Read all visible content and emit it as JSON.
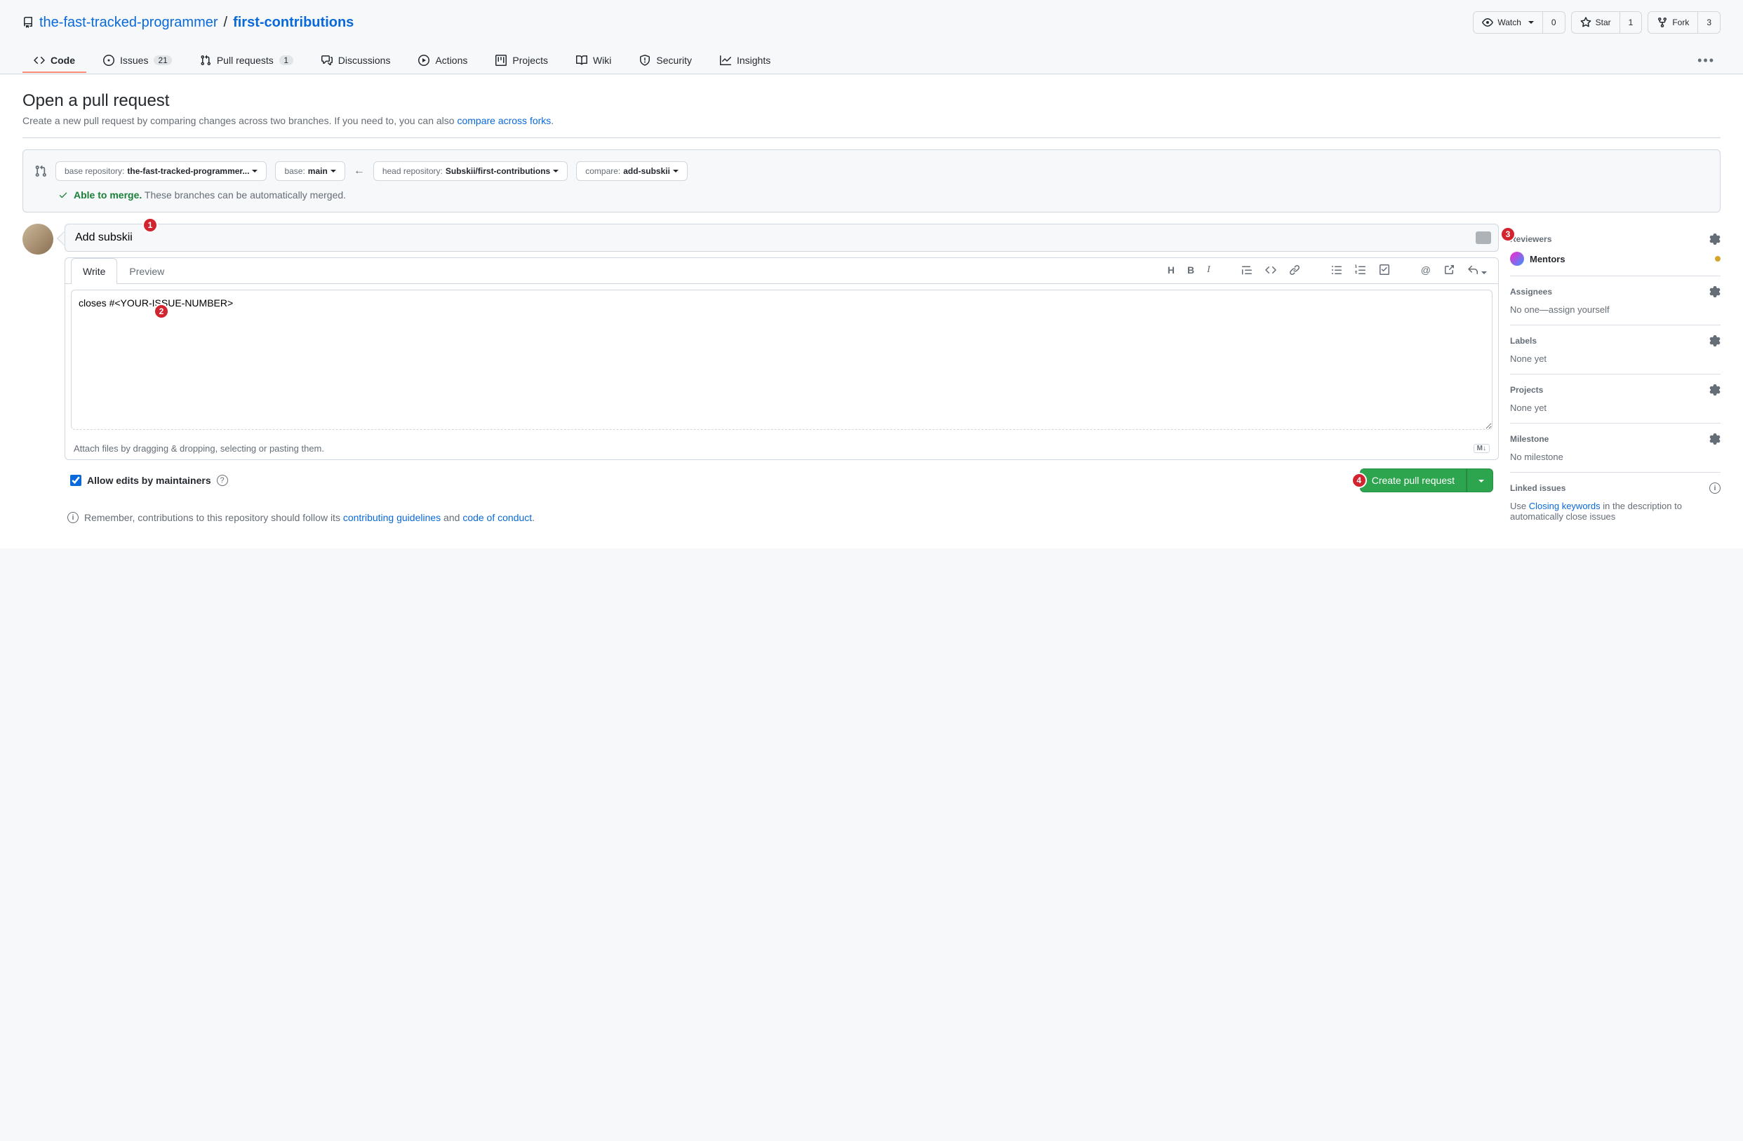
{
  "repo": {
    "owner": "the-fast-tracked-programmer",
    "name": "first-contributions",
    "watch_label": "Watch",
    "watch_count": "0",
    "star_label": "Star",
    "star_count": "1",
    "fork_label": "Fork",
    "fork_count": "3"
  },
  "nav": {
    "tabs": [
      {
        "label": "Code"
      },
      {
        "label": "Issues",
        "count": "21"
      },
      {
        "label": "Pull requests",
        "count": "1"
      },
      {
        "label": "Discussions"
      },
      {
        "label": "Actions"
      },
      {
        "label": "Projects"
      },
      {
        "label": "Wiki"
      },
      {
        "label": "Security"
      },
      {
        "label": "Insights"
      }
    ]
  },
  "page": {
    "title": "Open a pull request",
    "subtitle_pre": "Create a new pull request by comparing changes across two branches. If you need to, you can also ",
    "subtitle_link": "compare across forks",
    "subtitle_post": "."
  },
  "compare": {
    "base_repo_label": "base repository: ",
    "base_repo_value": "the-fast-tracked-programmer...",
    "base_label": "base: ",
    "base_value": "main",
    "head_repo_label": "head repository: ",
    "head_repo_value": "Subskii/first-contributions",
    "compare_label": "compare: ",
    "compare_value": "add-subskii",
    "merge_ok_prefix": "Able to merge.",
    "merge_ok_suffix": " These branches can be automatically merged."
  },
  "form": {
    "title_value": "Add subskii",
    "write_tab": "Write",
    "preview_tab": "Preview",
    "body_value": "closes #<YOUR-ISSUE-NUMBER>",
    "attach_hint": "Attach files by dragging & dropping, selecting or pasting them.",
    "md_badge": "M↓",
    "allow_edits_label": "Allow edits by maintainers",
    "submit_label": "Create pull request"
  },
  "contrib": {
    "pre": "Remember, contributions to this repository should follow its ",
    "link1": "contributing guidelines",
    "mid": " and ",
    "link2": "code of conduct",
    "post": "."
  },
  "sidebar": {
    "reviewers": {
      "title": "Reviewers",
      "item_label": "Mentors"
    },
    "assignees": {
      "title": "Assignees",
      "body_pre": "No one—",
      "body_link": "assign yourself"
    },
    "labels": {
      "title": "Labels",
      "body": "None yet"
    },
    "projects": {
      "title": "Projects",
      "body": "None yet"
    },
    "milestone": {
      "title": "Milestone",
      "body": "No milestone"
    },
    "linked": {
      "title": "Linked issues",
      "body_pre": "Use ",
      "body_link": "Closing keywords",
      "body_post": " in the description to automatically close issues"
    }
  },
  "annotations": {
    "a1": "1",
    "a2": "2",
    "a3": "3",
    "a4": "4"
  }
}
